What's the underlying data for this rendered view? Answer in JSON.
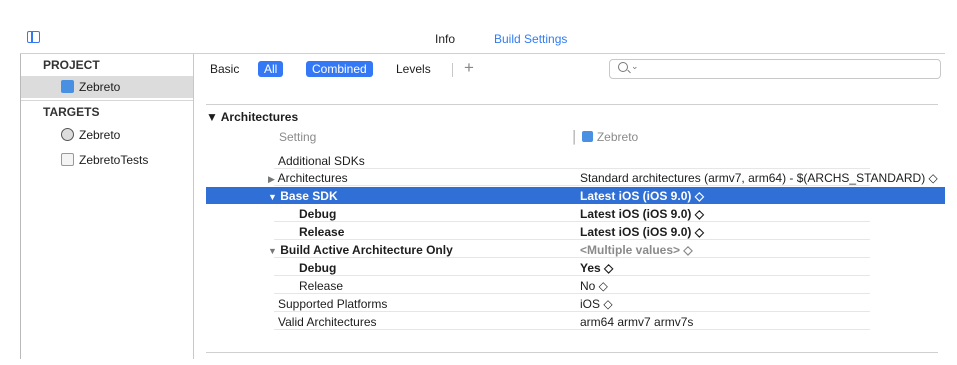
{
  "tabs": {
    "info": "Info",
    "build_settings": "Build Settings"
  },
  "sidebar": {
    "project_header": "PROJECT",
    "project_item": "Zebreto",
    "targets_header": "TARGETS",
    "targets": [
      "Zebreto",
      "ZebretoTests"
    ]
  },
  "filter": {
    "basic": "Basic",
    "all": "All",
    "combined": "Combined",
    "levels": "Levels",
    "add": "+",
    "search_value": ""
  },
  "section": {
    "title": "Architectures",
    "header_setting": "Setting",
    "header_target": "Zebreto",
    "rows": [
      {
        "name": "Additional SDKs",
        "value": ""
      },
      {
        "name": "Architectures",
        "value": "Standard architectures (armv7, arm64)  -  $(ARCHS_STANDARD) ◇"
      },
      {
        "name": "Base SDK",
        "value": "Latest iOS (iOS 9.0) ◇"
      },
      {
        "name": "Debug",
        "value": "Latest iOS (iOS 9.0) ◇"
      },
      {
        "name": "Release",
        "value": "Latest iOS (iOS 9.0) ◇"
      },
      {
        "name": "Build Active Architecture Only",
        "value": "<Multiple values> ◇"
      },
      {
        "name": "Debug",
        "value": "Yes ◇"
      },
      {
        "name": "Release",
        "value": "No ◇"
      },
      {
        "name": "Supported Platforms",
        "value": "iOS ◇"
      },
      {
        "name": "Valid Architectures",
        "value": "arm64 armv7 armv7s"
      }
    ]
  },
  "colors": {
    "accent": "#3478f6",
    "selection": "#2f6fd6"
  }
}
